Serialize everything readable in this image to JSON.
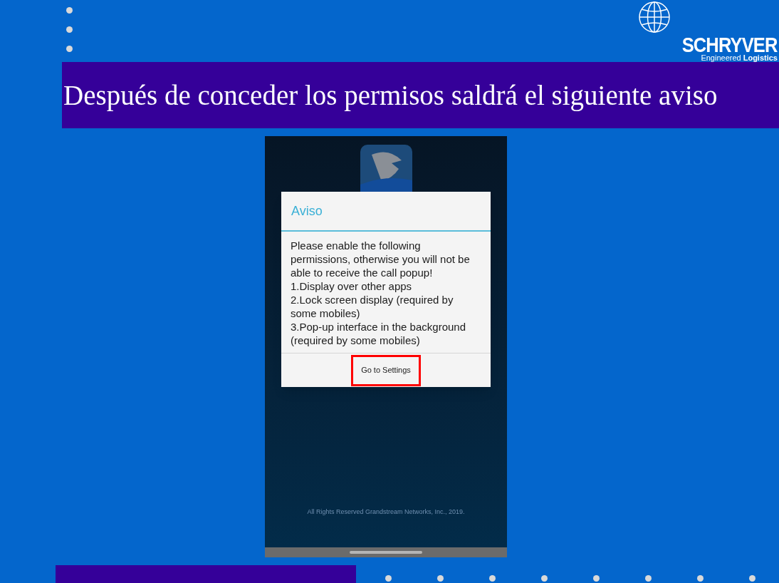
{
  "logo": {
    "name": "SCHRYVER",
    "tagline": "Engineered **Logistics**"
  },
  "slide_title": "Después de conceder los permisos saldrá el siguiente aviso",
  "phone": {
    "dialog": {
      "title": "Aviso",
      "message": [
        "Please enable the following permissions, otherwise you will not be able to receive the call popup!",
        "1.Display over other apps",
        "2.Lock screen display (required by some mobiles)",
        "3.Pop-up interface in the background (required by some mobiles)"
      ],
      "button": {
        "label": "Go to Settings",
        "highlighted": true
      }
    },
    "footer": "All Rights Reserved Grandstream Networks, Inc., 2019."
  }
}
